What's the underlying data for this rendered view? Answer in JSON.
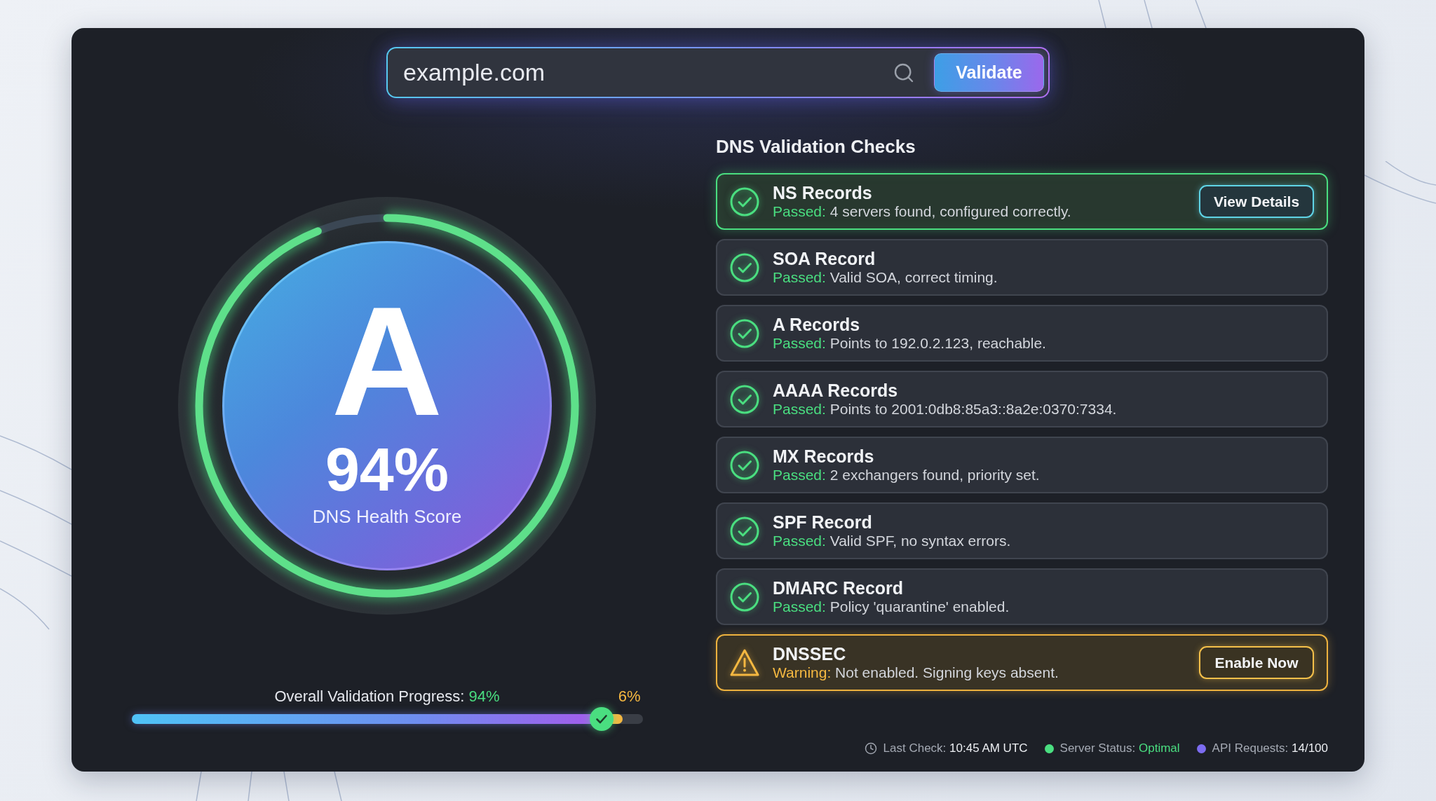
{
  "search": {
    "value": "example.com",
    "button": "Validate"
  },
  "score": {
    "grade": "A",
    "percent": "94%",
    "label": "DNS Health Score",
    "level": 0.94
  },
  "progress": {
    "label": "Overall Validation Progress:",
    "value": "94%",
    "remaining": "6%",
    "level": 0.92
  },
  "checks_panel": {
    "title": "DNS Validation Checks",
    "checks": [
      {
        "kind": "passed",
        "selected": true,
        "name": "NS Records",
        "status": "Passed:",
        "detail": "4 servers found, configured correctly.",
        "action": "View Details"
      },
      {
        "kind": "passed",
        "selected": false,
        "name": "SOA Record",
        "status": "Passed:",
        "detail": "Valid SOA, correct timing."
      },
      {
        "kind": "passed",
        "selected": false,
        "name": "A Records",
        "status": "Passed:",
        "detail": "Points to 192.0.2.123, reachable."
      },
      {
        "kind": "passed",
        "selected": false,
        "name": "AAAA Records",
        "status": "Passed:",
        "detail": "Points to 2001:0db8:85a3::8a2e:0370:7334."
      },
      {
        "kind": "passed",
        "selected": false,
        "name": "MX Records",
        "status": "Passed:",
        "detail": "2 exchangers found, priority set."
      },
      {
        "kind": "passed",
        "selected": false,
        "name": "SPF Record",
        "status": "Passed:",
        "detail": "Valid SPF, no syntax errors."
      },
      {
        "kind": "passed",
        "selected": false,
        "name": "DMARC Record",
        "status": "Passed:",
        "detail": "Policy 'quarantine' enabled."
      },
      {
        "kind": "warning",
        "selected": false,
        "name": "DNSSEC",
        "status": "Warning:",
        "detail": "Not enabled. Signing keys absent.",
        "action": "Enable Now"
      }
    ]
  },
  "status_bar": {
    "items": [
      {
        "kind": "time",
        "label": "Last Check:",
        "value": "10:45 AM UTC"
      },
      {
        "kind": "status",
        "label": "Server Status:",
        "value": "Optimal",
        "color": "#4ade80"
      },
      {
        "kind": "usage",
        "label": "API Requests:",
        "value": "14/100",
        "color": "#7c6cf0"
      }
    ]
  }
}
